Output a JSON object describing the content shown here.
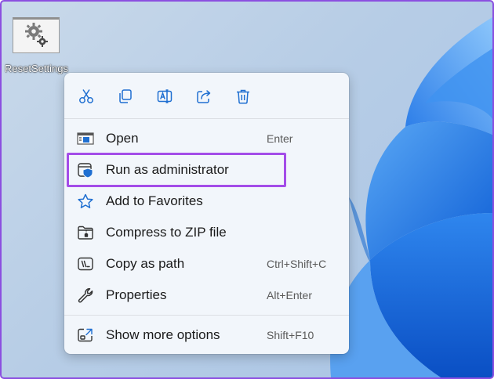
{
  "desktop": {
    "file_label": "ResetSettings"
  },
  "colors": {
    "highlight_outline": "#a44de8",
    "accent_blue": "#1f6fd1",
    "menu_background": "#f2f6fb"
  },
  "context_menu": {
    "quick_actions": [
      {
        "name": "cut",
        "icon": "scissors-icon"
      },
      {
        "name": "copy",
        "icon": "copy-icon"
      },
      {
        "name": "rename",
        "icon": "rename-icon"
      },
      {
        "name": "share",
        "icon": "share-icon"
      },
      {
        "name": "delete",
        "icon": "trash-icon"
      }
    ],
    "items": [
      {
        "label": "Open",
        "shortcut": "Enter",
        "icon": "open-window-icon"
      },
      {
        "label": "Run as administrator",
        "shortcut": "",
        "icon": "admin-shield-icon"
      },
      {
        "label": "Add to Favorites",
        "shortcut": "",
        "icon": "star-icon"
      },
      {
        "label": "Compress to ZIP file",
        "shortcut": "",
        "icon": "zip-folder-icon"
      },
      {
        "label": "Copy as path",
        "shortcut": "Ctrl+Shift+C",
        "icon": "copy-path-icon"
      },
      {
        "label": "Properties",
        "shortcut": "Alt+Enter",
        "icon": "wrench-icon"
      },
      {
        "label": "Show more options",
        "shortcut": "Shift+F10",
        "icon": "more-options-icon"
      }
    ]
  }
}
